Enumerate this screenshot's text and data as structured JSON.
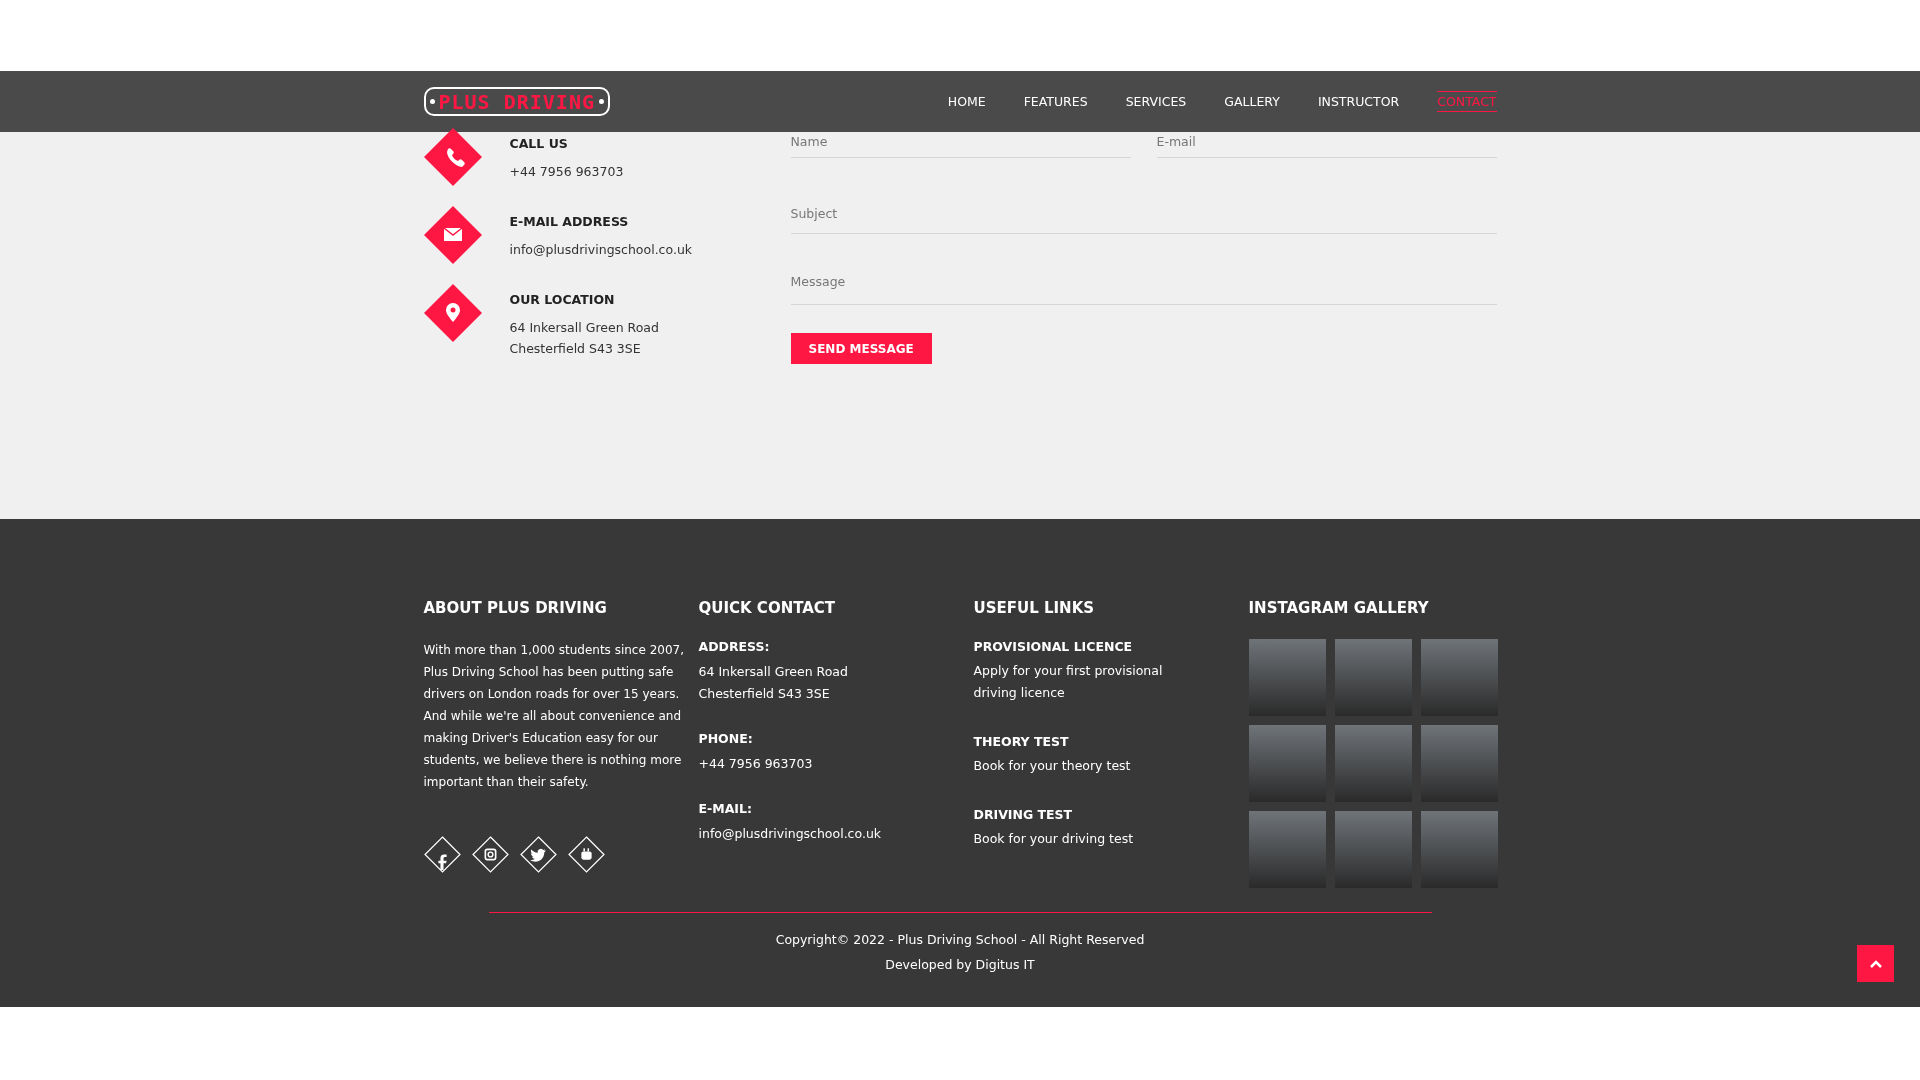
{
  "nav": {
    "logo": "PLUS DRIVING",
    "items": [
      {
        "label": "HOME",
        "selected": false
      },
      {
        "label": "FEATURES",
        "selected": false
      },
      {
        "label": "SERVICES",
        "selected": false
      },
      {
        "label": "GALLERY",
        "selected": false
      },
      {
        "label": "INSTRUCTOR",
        "selected": false
      },
      {
        "label": "CONTACT",
        "selected": true
      }
    ]
  },
  "contact_info": [
    {
      "kind": "phone",
      "title": "CALL US",
      "lines": [
        "+44 7956 963703"
      ]
    },
    {
      "kind": "email",
      "title": "E-MAIL ADDRESS",
      "lines": [
        "info@plusdrivingschool.co.uk"
      ]
    },
    {
      "kind": "location",
      "title": "OUR LOCATION",
      "lines": [
        "64 Inkersall Green Road",
        "Chesterfield S43 3SE"
      ]
    }
  ],
  "form": {
    "name_field": {
      "placeholder": "Name"
    },
    "email_field": {
      "placeholder": "E-mail"
    },
    "subject_field": {
      "placeholder": "Subject"
    },
    "message_field": {
      "placeholder": "Message"
    },
    "submit": "SEND MESSAGE"
  },
  "footer": {
    "about": {
      "title": "ABOUT PLUS DRIVING",
      "text": "With more than 1,000 students since 2007, Plus Driving School has been putting safe drivers on London roads for over 15 years. And while we're all about convenience and making Driver's Education easy for our students, we believe there is nothing more important than their safety."
    },
    "social": [
      {
        "kind": "facebook"
      },
      {
        "kind": "instagram"
      },
      {
        "kind": "twitter"
      },
      {
        "kind": "youtube"
      }
    ],
    "quick_contact": {
      "title": "QUICK CONTACT",
      "items": [
        {
          "label": "ADDRESS:",
          "lines": [
            "64 Inkersall Green Road",
            "Chesterfield S43 3SE"
          ]
        },
        {
          "label": "PHONE:",
          "lines": [
            "+44 7956 963703"
          ]
        },
        {
          "label": "E-MAIL:",
          "lines": [
            "info@plusdrivingschool.co.uk"
          ]
        }
      ]
    },
    "useful_links": {
      "title": "USEFUL LINKS",
      "links": [
        {
          "title": "PROVISIONAL LICENCE",
          "text": "Apply for your first provisional driving licence"
        },
        {
          "title": "THEORY TEST",
          "text": "Book for your theory test"
        },
        {
          "title": "DRIVING TEST",
          "text": "Book for your driving test"
        }
      ]
    },
    "instagram": {
      "title": "INSTAGRAM GALLERY"
    },
    "copyright": "Copyright© 2022 - Plus Driving School - All Right Reserved",
    "developed": "Developed by Digitus IT"
  }
}
